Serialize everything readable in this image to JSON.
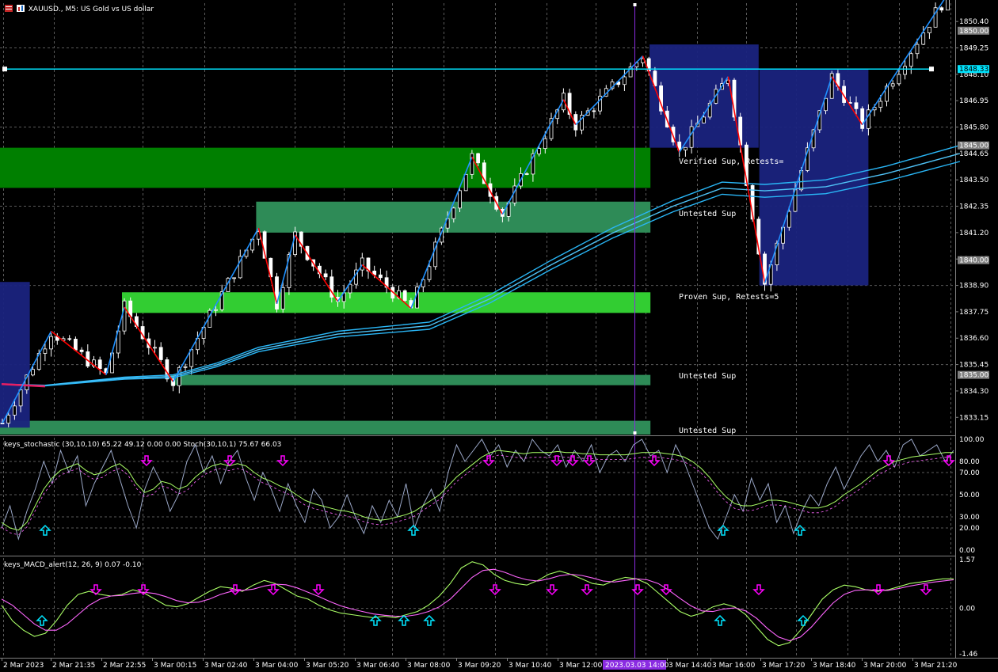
{
  "header": {
    "symbol": "XAUUSD.",
    "timeframe": "M5",
    "description": "US Gold vs US dollar"
  },
  "colors": {
    "background": "#000000",
    "candle": "#ffffff",
    "zigzag_up": "#1e90ff",
    "zigzag_down": "#ff0000",
    "ma": "#29b6f6",
    "hline": "#00e5ff",
    "zone_verified": "#007f00",
    "zone_untested": "#2e8b57",
    "zone_proven": "#32cd32",
    "box": "#1a237e",
    "stoch_main": "#9aa7c7",
    "stoch_signal": "#aaff66",
    "macd_main": "#aaff66",
    "macd_signal": "#ff66ff",
    "arrow_up": "#00e5ff",
    "arrow_down": "#ff00ff",
    "vline": "#8a2be2"
  },
  "chart_data": [
    {
      "type": "line",
      "panel": "price",
      "ylim": [
        1832.4,
        1851.2
      ],
      "y_ticks": [
        "1850.40",
        "1849.25",
        "1848.10",
        "1846.95",
        "1845.80",
        "1844.65",
        "1843.50",
        "1842.35",
        "1841.20",
        "1840.05",
        "1838.90",
        "1837.75",
        "1836.60",
        "1835.45",
        "1834.30",
        "1833.15"
      ],
      "price_labels": [
        {
          "value": 1850.0,
          "text": "1850.00",
          "style": "gray"
        },
        {
          "value": 1848.33,
          "text": "1848.33",
          "style": "cyan"
        },
        {
          "value": 1845.0,
          "text": "1845.00",
          "style": "gray"
        },
        {
          "value": 1840.0,
          "text": "1840.00",
          "style": "gray"
        },
        {
          "value": 1835.0,
          "text": "1835.00",
          "style": "gray"
        }
      ],
      "zones": [
        {
          "label": "Verified Sup, Retests=",
          "start": 0,
          "end": 106,
          "top": 1844.9,
          "bottom": 1843.15,
          "kind": "verified"
        },
        {
          "label": "Untested Sup",
          "start": 42,
          "end": 106,
          "top": 1842.55,
          "bottom": 1841.2,
          "kind": "untested"
        },
        {
          "label": "Proven Sup, Retests=5",
          "start": 20,
          "end": 106,
          "top": 1838.6,
          "bottom": 1837.7,
          "kind": "proven"
        },
        {
          "label": "Untested Sup",
          "start": 28,
          "end": 106,
          "top": 1835.0,
          "bottom": 1834.55,
          "kind": "untested"
        },
        {
          "label": "Untested Sup",
          "start": 0,
          "end": 106,
          "top": 1833.0,
          "bottom": 1832.4,
          "kind": "untested"
        }
      ],
      "boxes": [
        {
          "start": 0,
          "end": 4.5,
          "top": 1839.05,
          "bottom": 1832.7
        },
        {
          "start": 106.5,
          "end": 124,
          "top": 1849.4,
          "bottom": 1844.9
        },
        {
          "start": 124.5,
          "end": 142,
          "top": 1848.3,
          "bottom": 1838.9
        }
      ],
      "hline": 1848.33,
      "zigzag": [
        {
          "i": 0,
          "v": 1832.9
        },
        {
          "i": 8,
          "v": 1836.9
        },
        {
          "i": 17,
          "v": 1835.0
        },
        {
          "i": 20,
          "v": 1837.95
        },
        {
          "i": 28,
          "v": 1834.7
        },
        {
          "i": 42,
          "v": 1841.4
        },
        {
          "i": 45,
          "v": 1838.1
        },
        {
          "i": 48,
          "v": 1841.1
        },
        {
          "i": 55,
          "v": 1838.2
        },
        {
          "i": 59,
          "v": 1839.8
        },
        {
          "i": 67,
          "v": 1837.9
        },
        {
          "i": 77,
          "v": 1844.5
        },
        {
          "i": 82,
          "v": 1842.0
        },
        {
          "i": 92,
          "v": 1847.0
        },
        {
          "i": 94,
          "v": 1845.9
        },
        {
          "i": 105,
          "v": 1848.9
        },
        {
          "i": 111,
          "v": 1844.7
        },
        {
          "i": 119,
          "v": 1848.0
        },
        {
          "i": 125,
          "v": 1839.0
        },
        {
          "i": 136,
          "v": 1848.0
        },
        {
          "i": 141,
          "v": 1845.9
        },
        {
          "i": 156,
          "v": 1852.0
        }
      ],
      "ma": [
        {
          "i": 0,
          "v": 1834.6
        },
        {
          "i": 7,
          "v": 1834.55
        },
        {
          "i": 20,
          "v": 1834.9
        },
        {
          "i": 28,
          "v": 1835.0
        },
        {
          "i": 35,
          "v": 1835.5
        },
        {
          "i": 42,
          "v": 1836.2
        },
        {
          "i": 55,
          "v": 1836.9
        },
        {
          "i": 70,
          "v": 1837.3
        },
        {
          "i": 80,
          "v": 1838.5
        },
        {
          "i": 90,
          "v": 1840.0
        },
        {
          "i": 100,
          "v": 1841.4
        },
        {
          "i": 110,
          "v": 1842.6
        },
        {
          "i": 118,
          "v": 1843.4
        },
        {
          "i": 125,
          "v": 1843.3
        },
        {
          "i": 135,
          "v": 1843.5
        },
        {
          "i": 145,
          "v": 1844.1
        },
        {
          "i": 157,
          "v": 1845.0
        }
      ],
      "cursor_index": 100
    },
    {
      "type": "line",
      "panel": "stochastic",
      "title": "keys_stochastic (30,10,10) 65.22 49.12 0.00 0.00 Stoch(30,10,1) 75.67 66.03",
      "ylim": [
        0,
        100
      ],
      "y_ticks": [
        "100.00",
        "80.00",
        "70.00",
        "50.00",
        "30.00",
        "20.00",
        "0.00"
      ],
      "levels": [
        80,
        70,
        50,
        30,
        20
      ],
      "series": [
        {
          "role": "main",
          "values": [
            20,
            40,
            10,
            35,
            55,
            80,
            60,
            90,
            70,
            85,
            40,
            60,
            75,
            90,
            65,
            40,
            20,
            55,
            75,
            60,
            35,
            50,
            80,
            95,
            70,
            85,
            60,
            80,
            90,
            65,
            45,
            70,
            55,
            35,
            60,
            40,
            25,
            55,
            45,
            20,
            30,
            50,
            30,
            15,
            40,
            25,
            45,
            30,
            60,
            20,
            40,
            55,
            35,
            70,
            95,
            80,
            90,
            100,
            85,
            95,
            75,
            90,
            80,
            100,
            90,
            85,
            95,
            75,
            90,
            80,
            95,
            70,
            85,
            90,
            80,
            95,
            100,
            85,
            90,
            70,
            95,
            80,
            60,
            40,
            20,
            10,
            30,
            50,
            35,
            65,
            45,
            60,
            25,
            40,
            15,
            35,
            50,
            40,
            60,
            75,
            55,
            70,
            85,
            95,
            80,
            90,
            75,
            95,
            100,
            85,
            90,
            95,
            80,
            90
          ]
        },
        {
          "role": "signal",
          "values": [
            25,
            20,
            18,
            25,
            40,
            55,
            65,
            72,
            75,
            78,
            72,
            68,
            70,
            75,
            78,
            72,
            60,
            52,
            55,
            62,
            60,
            55,
            58,
            66,
            72,
            76,
            78,
            76,
            78,
            76,
            70,
            65,
            62,
            58,
            55,
            50,
            45,
            42,
            40,
            38,
            36,
            35,
            33,
            30,
            28,
            27,
            28,
            30,
            32,
            35,
            40,
            45,
            50,
            58,
            66,
            72,
            78,
            84,
            88,
            90,
            89,
            88,
            87,
            88,
            88,
            88,
            89,
            88,
            88,
            87,
            87,
            86,
            86,
            86,
            86,
            87,
            88,
            88,
            88,
            87,
            86,
            84,
            80,
            74,
            66,
            56,
            48,
            42,
            40,
            40,
            42,
            45,
            45,
            44,
            42,
            40,
            38,
            38,
            40,
            44,
            50,
            55,
            60,
            66,
            72,
            76,
            80,
            82,
            84,
            85,
            86,
            87,
            88,
            88
          ]
        }
      ]
    },
    {
      "type": "line",
      "panel": "macd",
      "title": "keys_MACD_alert(12, 26, 9) 0.07 -0.10",
      "ylim": [
        -1.46,
        1.57
      ],
      "y_ticks": [
        "1.57",
        "0.00",
        "-1.46"
      ],
      "levels": [
        0
      ],
      "series": [
        {
          "role": "main",
          "values": [
            0.1,
            -0.4,
            -0.7,
            -0.9,
            -0.8,
            -0.4,
            0.1,
            0.45,
            0.55,
            0.45,
            0.4,
            0.45,
            0.6,
            0.5,
            0.3,
            0.1,
            0.05,
            0.15,
            0.35,
            0.55,
            0.7,
            0.65,
            0.55,
            0.75,
            0.9,
            0.8,
            0.6,
            0.4,
            0.3,
            0.1,
            -0.05,
            -0.15,
            -0.2,
            -0.25,
            -0.3,
            -0.25,
            -0.3,
            -0.2,
            -0.1,
            0.1,
            0.4,
            0.8,
            1.3,
            1.5,
            1.4,
            1.1,
            0.9,
            0.8,
            0.75,
            0.9,
            1.1,
            1.2,
            1.1,
            0.95,
            0.8,
            0.75,
            0.9,
            1.0,
            0.95,
            0.8,
            0.5,
            0.2,
            -0.1,
            -0.25,
            -0.15,
            0.05,
            0.15,
            0.05,
            -0.2,
            -0.6,
            -1.0,
            -1.2,
            -1.1,
            -0.7,
            -0.2,
            0.3,
            0.6,
            0.75,
            0.7,
            0.6,
            0.55,
            0.6,
            0.7,
            0.8,
            0.85,
            0.9,
            0.95,
            0.95
          ]
        },
        {
          "role": "signal",
          "values": [
            0.3,
            0.1,
            -0.2,
            -0.5,
            -0.7,
            -0.7,
            -0.5,
            -0.2,
            0.1,
            0.3,
            0.4,
            0.42,
            0.48,
            0.52,
            0.48,
            0.38,
            0.25,
            0.18,
            0.2,
            0.3,
            0.45,
            0.55,
            0.58,
            0.62,
            0.72,
            0.78,
            0.76,
            0.66,
            0.52,
            0.38,
            0.22,
            0.08,
            -0.02,
            -0.1,
            -0.18,
            -0.22,
            -0.25,
            -0.25,
            -0.2,
            -0.1,
            0.05,
            0.3,
            0.65,
            1.0,
            1.22,
            1.26,
            1.16,
            1.02,
            0.92,
            0.88,
            0.95,
            1.05,
            1.1,
            1.06,
            0.98,
            0.88,
            0.85,
            0.9,
            0.95,
            0.92,
            0.8,
            0.58,
            0.32,
            0.08,
            -0.08,
            -0.1,
            -0.02,
            0.02,
            -0.08,
            -0.32,
            -0.65,
            -0.92,
            -1.04,
            -0.92,
            -0.6,
            -0.2,
            0.18,
            0.45,
            0.58,
            0.6,
            0.58,
            0.58,
            0.64,
            0.72,
            0.78,
            0.84,
            0.88,
            0.92
          ]
        }
      ]
    }
  ],
  "stoch_arrows": [
    {
      "dir": "up",
      "x": 57
    },
    {
      "dir": "down",
      "x": 185
    },
    {
      "dir": "down",
      "x": 290
    },
    {
      "dir": "down",
      "x": 357
    },
    {
      "dir": "up",
      "x": 522
    },
    {
      "dir": "down",
      "x": 617
    },
    {
      "dir": "down",
      "x": 703
    },
    {
      "dir": "down",
      "x": 723
    },
    {
      "dir": "down",
      "x": 744
    },
    {
      "dir": "down",
      "x": 826
    },
    {
      "dir": "up",
      "x": 913
    },
    {
      "dir": "up",
      "x": 1010
    },
    {
      "dir": "down",
      "x": 1122
    },
    {
      "dir": "down",
      "x": 1198
    }
  ],
  "macd_arrows": [
    {
      "dir": "up",
      "x": 53
    },
    {
      "dir": "down",
      "x": 121
    },
    {
      "dir": "down",
      "x": 181
    },
    {
      "dir": "down",
      "x": 297
    },
    {
      "dir": "down",
      "x": 345
    },
    {
      "dir": "down",
      "x": 402
    },
    {
      "dir": "up",
      "x": 474
    },
    {
      "dir": "up",
      "x": 510
    },
    {
      "dir": "up",
      "x": 542
    },
    {
      "dir": "down",
      "x": 625
    },
    {
      "dir": "down",
      "x": 697
    },
    {
      "dir": "down",
      "x": 741
    },
    {
      "dir": "down",
      "x": 805
    },
    {
      "dir": "down",
      "x": 841
    },
    {
      "dir": "up",
      "x": 909
    },
    {
      "dir": "down",
      "x": 958
    },
    {
      "dir": "up",
      "x": 1014
    },
    {
      "dir": "down",
      "x": 1109
    },
    {
      "dir": "down",
      "x": 1169
    }
  ],
  "x_axis": {
    "labels": [
      "2 Mar 2023",
      "2 Mar 21:35",
      "2 Mar 22:55",
      "3 Mar 00:15",
      "3 Mar 02:40",
      "3 Mar 04:00",
      "3 Mar 05:20",
      "3 Mar 06:40",
      "3 Mar 08:00",
      "3 Mar 09:20",
      "3 Mar 10:40",
      "3 Mar 12:00",
      "3 Mar 13:20",
      "3 Mar 14:40",
      "3 Mar 16:00",
      "3 Mar 17:20",
      "3 Mar 18:40",
      "3 Mar 20:00",
      "3 Mar 21:20"
    ],
    "cursor_label": "2023.03.03 14:00"
  }
}
